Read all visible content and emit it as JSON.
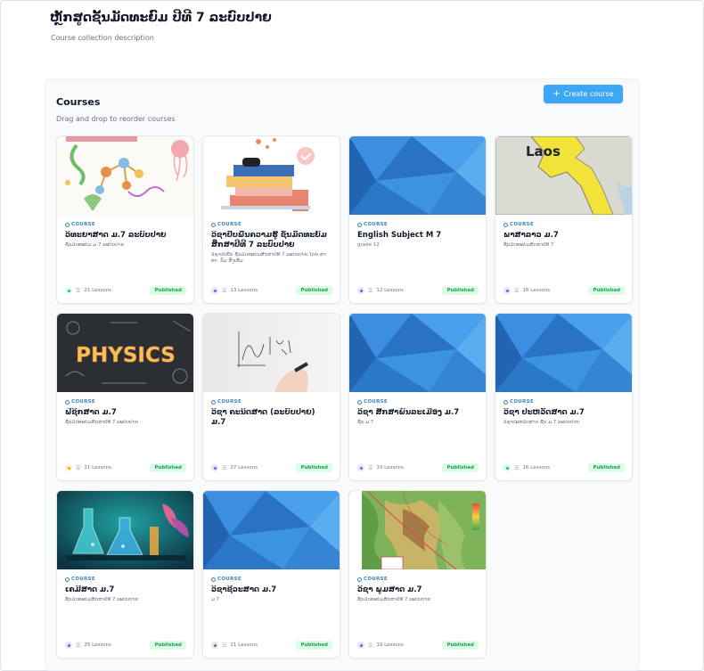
{
  "collection": {
    "title": "ຫຼັກສູດຊັ້ນມັດທະຍົມ ປີທີ 7 ລະບົບປາຍ",
    "description": "Course collection description"
  },
  "courses_section": {
    "title": "Courses",
    "subtitle": "Drag and drop to reorder courses",
    "create_label": "Create course"
  },
  "card_tag": "COURSE",
  "status_label": "Published",
  "courses": [
    {
      "title": "ວິທະຍາສາດ ມ.7 ລະບົບປາຍ",
      "desc": "ຊັ້ນມັດທະຍົມ ມ.7 ລະບົບປາຍ",
      "lessons": "21 Lessons",
      "thumb": "science-illustration"
    },
    {
      "title": "ວິຊາປັບພື້ນຄວາມຮູ້ ຊັ້ນມັດທະຍົມສຶກສາປີທີ 7 ລະບົບປາຍ",
      "desc": "ວິຊາປັບພື້ນ ຊັ້ນມັດທະຍົມສຶກສາປີທີ 7 ລະບົບປາຍ ໂດຍ ສາທາ. ກົມ ສົ່ງເສີມ",
      "lessons": "13 Lessons",
      "thumb": "books-illustration"
    },
    {
      "title": "English Subject M 7",
      "desc": "grade 12",
      "lessons": "12 Lessons",
      "thumb": "blue-polygon"
    },
    {
      "title": "ພາສາລາວ ມ.7",
      "desc": "ຊັ້ນມັດທະຍົມສຶກສາປີທີ 7",
      "lessons": "16 Lessons",
      "thumb": "laos-map",
      "map_label": "Laos"
    },
    {
      "title": "ຟີຊິກສາດ ມ.7",
      "desc": "ຊັ້ນມັດທະຍົມສຶກສາປີທີ 7 ລະບົບປາຍ",
      "lessons": "31 Lessons",
      "thumb": "physics-chalkboard",
      "board_word": "PHYSICS"
    },
    {
      "title": "ວິຊາ ຄະນິດສາດ (ລະບົບປາຍ) ມ.7",
      "desc": "",
      "lessons": "27 Lessons",
      "thumb": "whiteboard"
    },
    {
      "title": "ວິຊາ ສຶກສາພົນລະເມືອງ ມ.7",
      "desc": "ຊັ້ນ ມ.7",
      "lessons": "10 Lessons",
      "thumb": "blue-polygon"
    },
    {
      "title": "ວິຊາ ປະຫວັດສາດ ມ.7",
      "desc": "ວິຊາປະຫວັດສາດ ຊັ້ນ ມ.7 ລະບົບປາຍ",
      "lessons": "16 Lessons",
      "thumb": "blue-polygon"
    },
    {
      "title": "ເຄມີສາດ ມ.7",
      "desc": "ຊັ້ນມັດທະຍົມສຶກສາປີທີ 7 ລະບົບປາຍ",
      "lessons": "25 Lessons",
      "thumb": "chemistry-lab"
    },
    {
      "title": "ວິຊາຊີວະສາດ ມ.7",
      "desc": "ມ.7",
      "lessons": "21 Lessons",
      "thumb": "blue-polygon"
    },
    {
      "title": "ວິຊາ ພູມສາດ ມ.7",
      "desc": "ຊັ້ນມັດທະຍົມສຶກສາປີທີ 7 ລະບົບປາຍ",
      "lessons": "19 Lessons",
      "thumb": "topographic-map"
    }
  ],
  "colors": {
    "accent": "#3ea7f5",
    "published_text": "#16a34a",
    "published_bg": "#dcfce7"
  }
}
